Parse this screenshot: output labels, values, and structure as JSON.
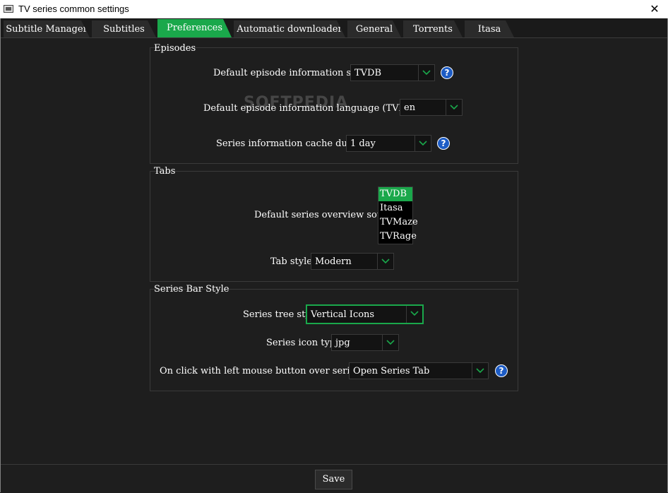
{
  "window": {
    "title": "TV series common settings",
    "close_glyph": "✕"
  },
  "tabs": [
    {
      "label": "Subtitle Manager"
    },
    {
      "label": "Subtitles"
    },
    {
      "label": "Preferences"
    },
    {
      "label": "Automatic downloader"
    },
    {
      "label": "General"
    },
    {
      "label": "Torrents"
    },
    {
      "label": "Itasa"
    }
  ],
  "active_tab": "Preferences",
  "watermark": "SOFTPEDIA",
  "episodes": {
    "title": "Episodes",
    "source_label": "Default episode information source",
    "source_value": "TVDB",
    "language_label": "Default episode information language (TVDB only)",
    "language_value": "en",
    "cache_label": "Series information cache duration",
    "cache_value": "1 day"
  },
  "tabs_group": {
    "title": "Tabs",
    "overview_label": "Default series overview source:",
    "overview_options": [
      "TVDB",
      "Itasa",
      "TVMaze",
      "TVRage"
    ],
    "overview_selected": "TVDB",
    "style_label": "Tab style",
    "style_value": "Modern"
  },
  "series_bar": {
    "title": "Series Bar Style",
    "tree_label": "Series tree style",
    "tree_value": "Vertical Icons",
    "icon_type_label": "Series icon type",
    "icon_type_value": "jpg",
    "click_label": "On click with left mouse button over series icon:",
    "click_value": "Open Series Tab"
  },
  "help_glyph": "?",
  "footer": {
    "save_label": "Save"
  },
  "colors": {
    "accent": "#1aa84b",
    "background": "#1e1e1e",
    "help": "#1d5cc5"
  },
  "icons": [
    "app-icon",
    "close-icon",
    "chevron-down-icon",
    "help-icon"
  ]
}
